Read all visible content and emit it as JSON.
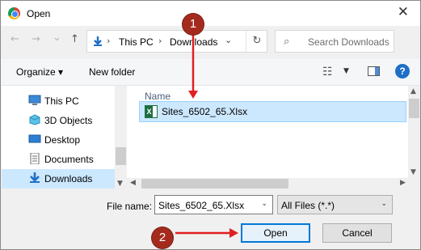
{
  "window": {
    "title": "Open",
    "close_glyph": "✕"
  },
  "nav": {
    "back_glyph": "←",
    "forward_glyph": "→",
    "history_glyph": "⌄",
    "up_glyph": "↑",
    "breadcrumb": [
      "This PC",
      "Downloads"
    ],
    "separator_glyph": "›",
    "dropdown_glyph": "⌄",
    "refresh_glyph": "↻",
    "search_placeholder": "Search Downloads",
    "search_glyph": "⌕"
  },
  "toolbar": {
    "organize_label": "Organize ▾",
    "new_folder_label": "New folder",
    "view_glyph": "☷",
    "view_dropdown_glyph": "▼",
    "help_glyph": "?"
  },
  "sidebar": {
    "items": [
      {
        "label": "This PC",
        "icon": "computer-icon"
      },
      {
        "label": "3D Objects",
        "icon": "cube-icon"
      },
      {
        "label": "Desktop",
        "icon": "desktop-icon"
      },
      {
        "label": "Documents",
        "icon": "document-icon"
      },
      {
        "label": "Downloads",
        "icon": "download-icon",
        "selected": true
      }
    ],
    "scroll_down_glyph": "▼"
  },
  "filelist": {
    "column_name": "Name",
    "files": [
      {
        "name": "Sites_6502_65.Xlsx",
        "icon": "excel-file-icon",
        "selected": true
      }
    ],
    "scroll_up_glyph": "▲",
    "scroll_down_glyph": "▼",
    "scroll_left_glyph": "◀",
    "scroll_right_glyph": "▶"
  },
  "footer": {
    "file_name_label": "File name:",
    "file_name_value": "Sites_6502_65.Xlsx",
    "file_type_value": "All Files (*.*)",
    "dropdown_glyph": "⌄",
    "open_label": "Open",
    "cancel_label": "Cancel"
  },
  "annotations": {
    "step1": "1",
    "step2": "2",
    "color": "#a52a1e",
    "arrow_color": "#e02020"
  },
  "colors": {
    "selection": "#cce8ff",
    "accent": "#0078d7"
  }
}
